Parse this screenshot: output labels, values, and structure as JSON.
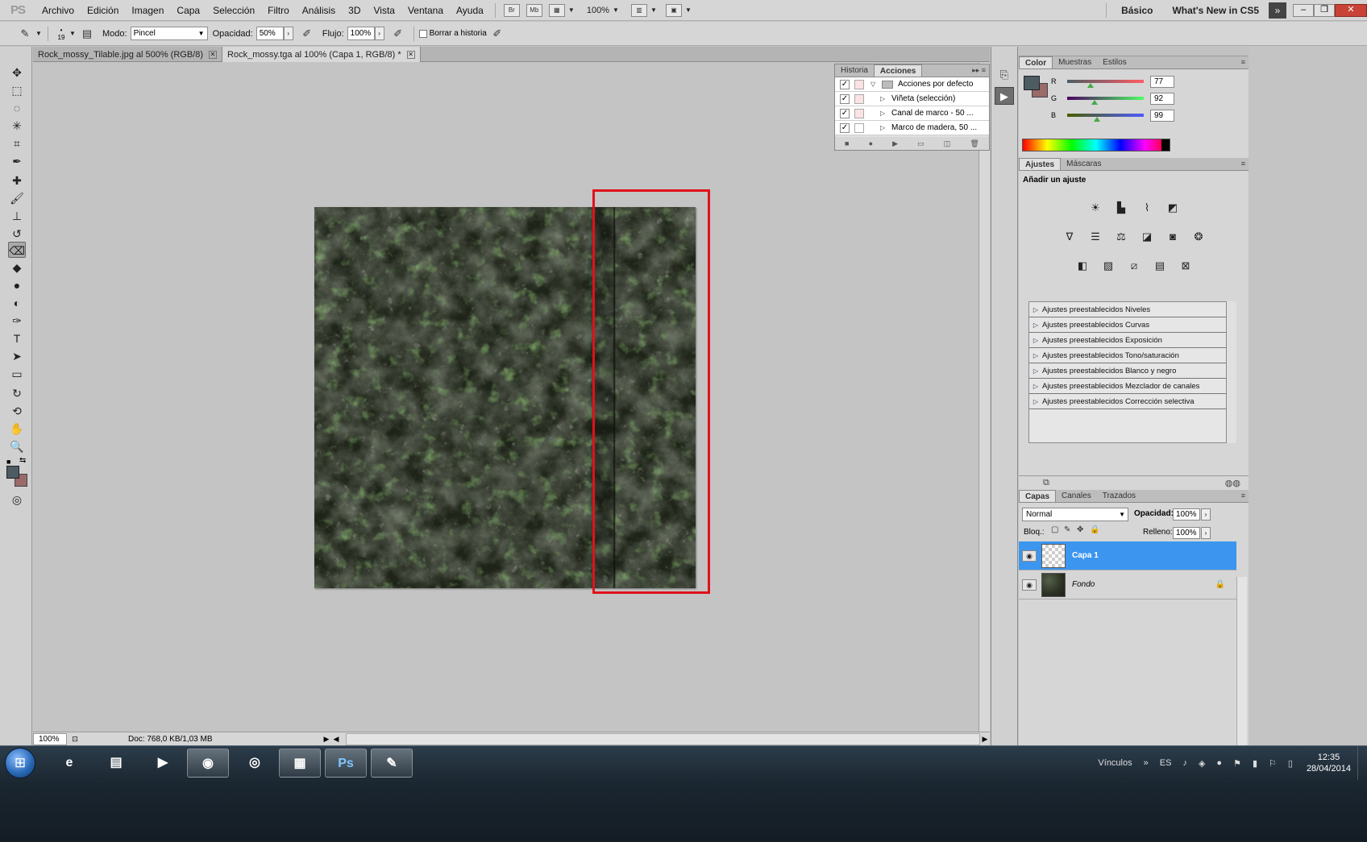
{
  "menubar": {
    "logo": "PS",
    "items": [
      "Archivo",
      "Edición",
      "Imagen",
      "Capa",
      "Selección",
      "Filtro",
      "Análisis",
      "3D",
      "Vista",
      "Ventana",
      "Ayuda"
    ],
    "bridge_label": "Br",
    "minibridge_label": "Mb",
    "zoom": "100%",
    "workspace": "Básico",
    "whats_new": "What's New in CS5"
  },
  "options": {
    "brush_size": "19",
    "mode_label": "Modo:",
    "mode_value": "Pincel",
    "opacity_label": "Opacidad:",
    "opacity_value": "50%",
    "flow_label": "Flujo:",
    "flow_value": "100%",
    "erase_history_label": "Borrar a historia"
  },
  "document": {
    "tabs": [
      {
        "label": "Rock_mossy_Tilable.jpg al 500% (RGB/8)",
        "active": false
      },
      {
        "label": "Rock_mossy.tga al 100% (Capa 1, RGB/8) *",
        "active": true
      }
    ],
    "zoom": "100%",
    "doc_info": "Doc: 768,0 KB/1,03 MB"
  },
  "actions_panel": {
    "tabs": [
      "Historia",
      "Acciones"
    ],
    "active_tab": "Acciones",
    "rows": [
      {
        "label": "Acciones por defecto",
        "type": "set"
      },
      {
        "label": "Viñeta (selección)",
        "type": "action"
      },
      {
        "label": "Canal de marco - 50 ...",
        "type": "action"
      },
      {
        "label": "Marco de madera, 50 ...",
        "type": "action"
      }
    ]
  },
  "color_panel": {
    "tabs": [
      "Color",
      "Muestras",
      "Estilos"
    ],
    "foreground": "#4d5c63",
    "background": "#9a6a68",
    "channels": [
      {
        "name": "R",
        "value": "77",
        "fraction": 0.302,
        "track": "linear-gradient(to right, #4d5c63, #ff5c63)"
      },
      {
        "name": "G",
        "value": "92",
        "fraction": 0.361,
        "track": "linear-gradient(to right, #4d0063, #4dff63)"
      },
      {
        "name": "B",
        "value": "99",
        "fraction": 0.388,
        "track": "linear-gradient(to right, #4d5c00, #4d5cff)"
      }
    ]
  },
  "adjustments_panel": {
    "tabs": [
      "Ajustes",
      "Máscaras"
    ],
    "title": "Añadir un ajuste",
    "icons_row1": [
      "brightness-icon",
      "levels-icon",
      "curves-icon",
      "exposure-icon"
    ],
    "icons_row2": [
      "vibrance-icon",
      "hue-saturation-icon",
      "color-balance-icon",
      "black-white-icon",
      "photo-filter-icon",
      "channel-mixer-icon"
    ],
    "icons_row3": [
      "invert-icon",
      "posterize-icon",
      "threshold-icon",
      "gradient-map-icon",
      "selective-color-icon"
    ],
    "presets": [
      "Ajustes preestablecidos Niveles",
      "Ajustes preestablecidos Curvas",
      "Ajustes preestablecidos Exposición",
      "Ajustes preestablecidos Tono/saturación",
      "Ajustes preestablecidos Blanco y negro",
      "Ajustes preestablecidos Mezclador de canales",
      "Ajustes preestablecidos Corrección selectiva"
    ]
  },
  "layers_panel": {
    "tabs": [
      "Capas",
      "Canales",
      "Trazados"
    ],
    "blend_mode": "Normal",
    "opacity_label": "Opacidad:",
    "opacity_value": "100%",
    "lock_label": "Bloq.:",
    "fill_label": "Relleno:",
    "fill_value": "100%",
    "layers": [
      {
        "name": "Capa 1",
        "selected": true,
        "locked": false
      },
      {
        "name": "Fondo",
        "selected": false,
        "locked": true
      }
    ]
  },
  "taskbar": {
    "links_label": "Vínculos",
    "language": "ES",
    "time": "12:35",
    "date": "28/04/2014",
    "photoshop_label": "Ps"
  }
}
